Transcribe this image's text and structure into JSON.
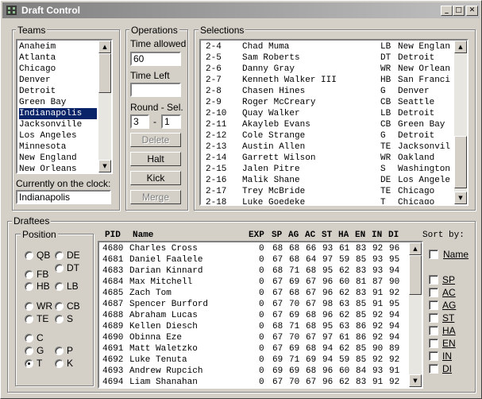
{
  "window": {
    "title": "Draft Control"
  },
  "teams": {
    "label": "Teams",
    "items": [
      "Anaheim",
      "Atlanta",
      "Chicago",
      "Denver",
      "Detroit",
      "Green Bay",
      "Indianapolis",
      "Jacksonville",
      "Los Angeles",
      "Minnesota",
      "New England",
      "New Orleans"
    ],
    "selected_index": 6,
    "clock_label": "Currently on the clock:",
    "clock_value": "Indianapolis"
  },
  "operations": {
    "label": "Operations",
    "time_allowed_label": "Time allowed",
    "time_allowed_value": "60",
    "time_left_label": "Time Left",
    "time_left_value": "",
    "round_sel_label": "Round - Sel.",
    "round_value": "3",
    "sep": "-",
    "sel_value": "1",
    "buttons": {
      "delete": "Delete",
      "halt": "Halt",
      "kick": "Kick",
      "merge": "Merge"
    }
  },
  "selections": {
    "label": "Selections",
    "rows": [
      {
        "pick": "2-4",
        "name": "Chad Muma",
        "pos": "LB",
        "team": "New Englan"
      },
      {
        "pick": "2-5",
        "name": "Sam Roberts",
        "pos": "DT",
        "team": "Detroit"
      },
      {
        "pick": "2-6",
        "name": "Danny Gray",
        "pos": "WR",
        "team": "New Orlean"
      },
      {
        "pick": "2-7",
        "name": "Kenneth Walker III",
        "pos": "HB",
        "team": "San Franci"
      },
      {
        "pick": "2-8",
        "name": "Chasen Hines",
        "pos": "G",
        "team": "Denver"
      },
      {
        "pick": "2-9",
        "name": "Roger McCreary",
        "pos": "CB",
        "team": "Seattle"
      },
      {
        "pick": "2-10",
        "name": "Quay Walker",
        "pos": "LB",
        "team": "Detroit"
      },
      {
        "pick": "2-11",
        "name": "Akayleb Evans",
        "pos": "CB",
        "team": "Green Bay"
      },
      {
        "pick": "2-12",
        "name": "Cole Strange",
        "pos": "G",
        "team": "Detroit"
      },
      {
        "pick": "2-13",
        "name": "Austin Allen",
        "pos": "TE",
        "team": "Jacksonvil"
      },
      {
        "pick": "2-14",
        "name": "Garrett Wilson",
        "pos": "WR",
        "team": "Oakland"
      },
      {
        "pick": "2-15",
        "name": "Jalen Pitre",
        "pos": "S",
        "team": "Washington"
      },
      {
        "pick": "2-16",
        "name": "Malik Shane",
        "pos": "DE",
        "team": "Los Angele"
      },
      {
        "pick": "2-17",
        "name": "Trey McBride",
        "pos": "TE",
        "team": "Chicago"
      },
      {
        "pick": "2-18",
        "name": "Luke Goedeke",
        "pos": "T",
        "team": "Chicago"
      }
    ]
  },
  "draftees": {
    "label": "Draftees",
    "position_label": "Position",
    "positions": [
      {
        "code": "QB",
        "selected": false
      },
      {
        "code": "DE",
        "selected": false
      },
      {
        "code": "DT",
        "selected": false
      },
      {
        "code": "FB",
        "selected": false
      },
      {
        "code": "HB",
        "selected": false
      },
      {
        "code": "LB",
        "selected": false
      },
      {
        "code": "WR",
        "selected": false
      },
      {
        "code": "CB",
        "selected": false
      },
      {
        "code": "TE",
        "selected": false
      },
      {
        "code": "S",
        "selected": false
      },
      {
        "code": "C",
        "selected": false
      },
      {
        "code": "G",
        "selected": false
      },
      {
        "code": "P",
        "selected": false
      },
      {
        "code": "T",
        "selected": true
      },
      {
        "code": "K",
        "selected": false
      }
    ],
    "columns": [
      "PID",
      "Name",
      "EXP",
      "SP",
      "AG",
      "AC",
      "ST",
      "HA",
      "EN",
      "IN",
      "DI"
    ],
    "rows": [
      {
        "pid": "4680",
        "name": "Charles Cross",
        "exp": "0",
        "sp": "68",
        "ag": "68",
        "ac": "66",
        "st": "93",
        "ha": "61",
        "en": "83",
        "in": "92",
        "di": "96"
      },
      {
        "pid": "4681",
        "name": "Daniel Faalele",
        "exp": "0",
        "sp": "67",
        "ag": "68",
        "ac": "64",
        "st": "97",
        "ha": "59",
        "en": "85",
        "in": "93",
        "di": "95"
      },
      {
        "pid": "4683",
        "name": "Darian Kinnard",
        "exp": "0",
        "sp": "68",
        "ag": "71",
        "ac": "68",
        "st": "95",
        "ha": "62",
        "en": "83",
        "in": "93",
        "di": "94"
      },
      {
        "pid": "4684",
        "name": "Max Mitchell",
        "exp": "0",
        "sp": "67",
        "ag": "69",
        "ac": "67",
        "st": "96",
        "ha": "60",
        "en": "81",
        "in": "87",
        "di": "90"
      },
      {
        "pid": "4685",
        "name": "Zach Tom",
        "exp": "0",
        "sp": "67",
        "ag": "68",
        "ac": "67",
        "st": "96",
        "ha": "62",
        "en": "83",
        "in": "91",
        "di": "92"
      },
      {
        "pid": "4687",
        "name": "Spencer Burford",
        "exp": "0",
        "sp": "67",
        "ag": "70",
        "ac": "67",
        "st": "98",
        "ha": "63",
        "en": "85",
        "in": "91",
        "di": "95"
      },
      {
        "pid": "4688",
        "name": "Abraham Lucas",
        "exp": "0",
        "sp": "67",
        "ag": "69",
        "ac": "68",
        "st": "96",
        "ha": "62",
        "en": "85",
        "in": "92",
        "di": "94"
      },
      {
        "pid": "4689",
        "name": "Kellen Diesch",
        "exp": "0",
        "sp": "68",
        "ag": "71",
        "ac": "68",
        "st": "95",
        "ha": "63",
        "en": "86",
        "in": "92",
        "di": "94"
      },
      {
        "pid": "4690",
        "name": "Obinna Eze",
        "exp": "0",
        "sp": "67",
        "ag": "70",
        "ac": "67",
        "st": "97",
        "ha": "61",
        "en": "86",
        "in": "92",
        "di": "94"
      },
      {
        "pid": "4691",
        "name": "Matt Waletzko",
        "exp": "0",
        "sp": "67",
        "ag": "69",
        "ac": "68",
        "st": "94",
        "ha": "62",
        "en": "85",
        "in": "90",
        "di": "89"
      },
      {
        "pid": "4692",
        "name": "Luke Tenuta",
        "exp": "0",
        "sp": "69",
        "ag": "71",
        "ac": "69",
        "st": "94",
        "ha": "59",
        "en": "85",
        "in": "92",
        "di": "92"
      },
      {
        "pid": "4693",
        "name": "Andrew Rupcich",
        "exp": "0",
        "sp": "69",
        "ag": "69",
        "ac": "68",
        "st": "96",
        "ha": "60",
        "en": "84",
        "in": "93",
        "di": "91"
      },
      {
        "pid": "4694",
        "name": "Liam Shanahan",
        "exp": "0",
        "sp": "67",
        "ag": "70",
        "ac": "67",
        "st": "96",
        "ha": "62",
        "en": "83",
        "in": "91",
        "di": "92"
      }
    ],
    "sort_by_label": "Sort by:",
    "sort_options": [
      "Name",
      "SP",
      "AC",
      "AG",
      "ST",
      "HA",
      "EN",
      "IN",
      "DI"
    ]
  }
}
